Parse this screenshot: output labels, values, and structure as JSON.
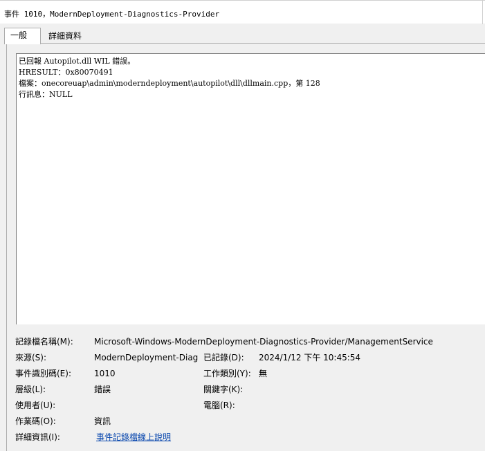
{
  "window": {
    "title": "事件 1010，ModernDeployment-Diagnostics-Provider"
  },
  "tabs": [
    {
      "label": "一般",
      "active": true
    },
    {
      "label": "詳細資料",
      "active": false
    }
  ],
  "description": {
    "lines": [
      "已回報 Autopilot.dll WIL 錯誤。",
      "HRESULT：0x80070491",
      "檔案：onecoreuap\\admin\\moderndeployment\\autopilot\\dll\\dllmain.cpp，第 128",
      "行訊息：NULL"
    ]
  },
  "details": {
    "log_name": {
      "label": "記錄檔名稱(M):",
      "value": "Microsoft-Windows-ModernDeployment-Diagnostics-Provider/ManagementService"
    },
    "source": {
      "label": "來源(S):",
      "value": "ModernDeployment-Diagno"
    },
    "logged": {
      "label": "已記錄(D):",
      "value": "2024/1/12 下午 10:45:54"
    },
    "event_id": {
      "label": "事件識別碼(E):",
      "value": "1010"
    },
    "task_category": {
      "label": "工作類別(Y):",
      "value": "無"
    },
    "level": {
      "label": "層級(L):",
      "value": "錯誤"
    },
    "keywords": {
      "label": "關鍵字(K):",
      "value": ""
    },
    "user": {
      "label": "使用者(U):",
      "value": ""
    },
    "computer": {
      "label": "電腦(R):",
      "value": ""
    },
    "opcode": {
      "label": "作業碼(O):",
      "value": "資訊"
    },
    "more_info": {
      "label": "詳細資訊(I):",
      "value": "事件記錄檔線上說明"
    }
  }
}
